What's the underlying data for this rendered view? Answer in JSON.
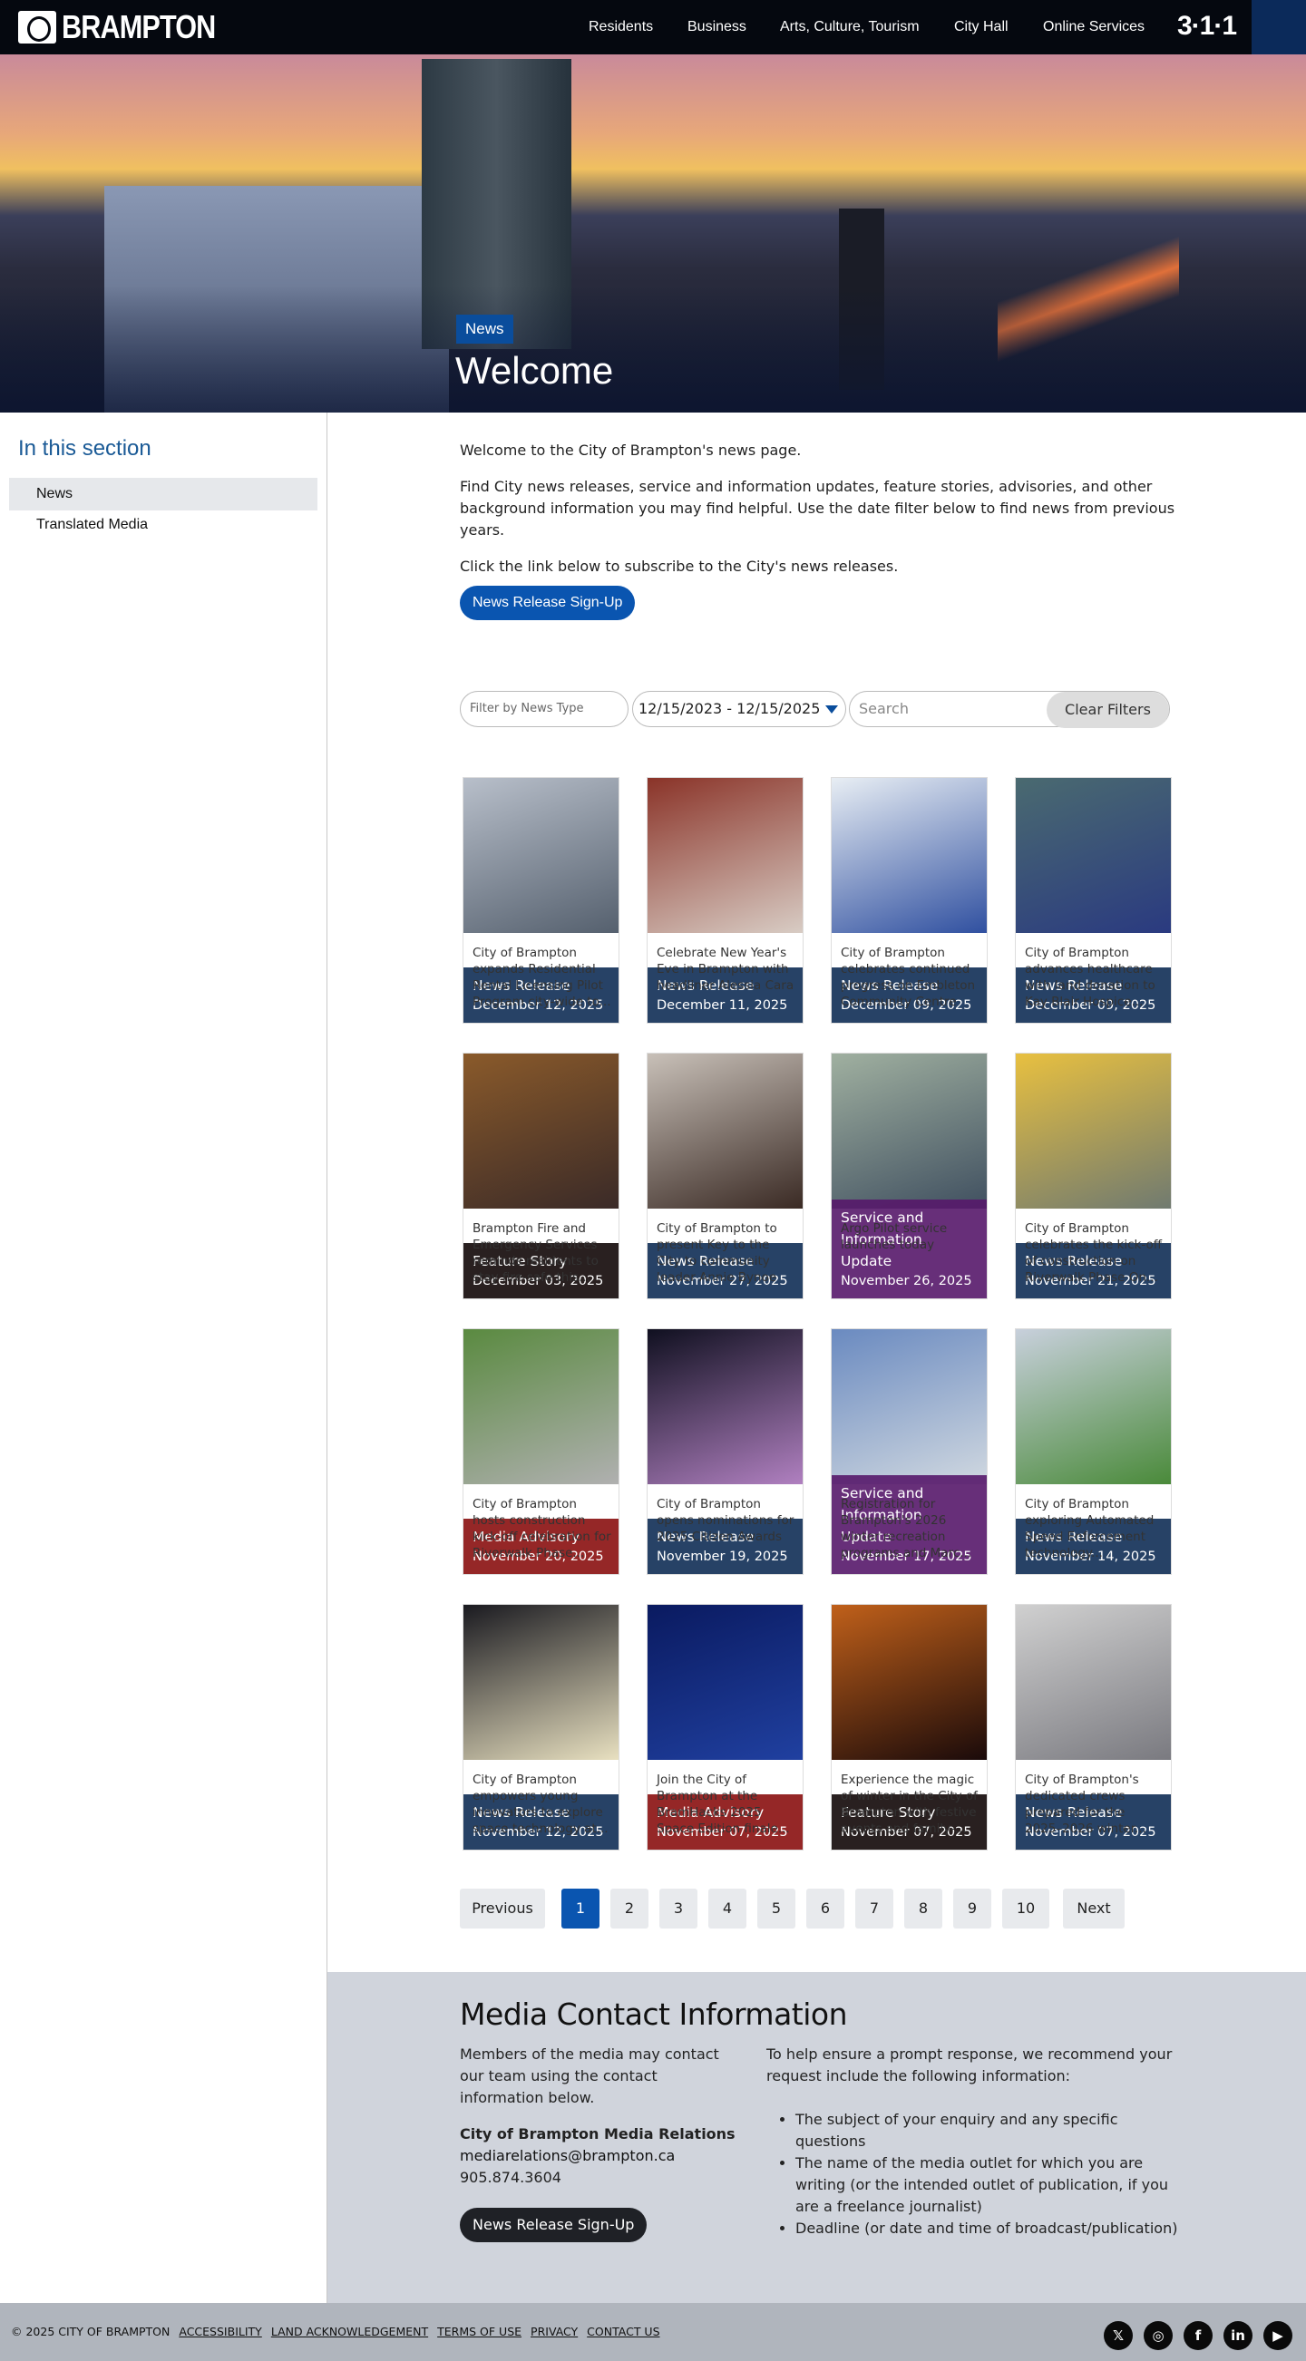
{
  "header": {
    "logo": "BRAMPTON",
    "nav": [
      "Residents",
      "Business",
      "Arts, Culture, Tourism",
      "City Hall",
      "Online Services"
    ],
    "logo_311": "3·1·1"
  },
  "hero": {
    "badge": "News",
    "title": "Welcome"
  },
  "sidebar": {
    "heading": "In this section",
    "items": [
      {
        "label": "News",
        "active": true
      },
      {
        "label": "Translated Media"
      }
    ]
  },
  "intro": {
    "p1": "Welcome to the City of Brampton's news page.",
    "p2": "Find City news releases, service and information updates, feature stories, advisories, and other background information you may find helpful. Use the date filter below to find news from previous years.",
    "p3": "Click the link below to subscribe to the City's news releases.",
    "signup": "News Release Sign-Up"
  },
  "filters": {
    "type_placeholder": "Filter by News Type",
    "date_range": "12/15/2023 - 12/15/2025",
    "search_placeholder": "Search",
    "clear": "Clear Filters"
  },
  "colors": {
    "News Release": "#0f2d55",
    "Media Advisory": "#8a1010",
    "Service and Information Update": "#56186a",
    "Feature Story": "#120808"
  },
  "cards": [
    {
      "type": "News Release",
      "date": "December 12, 2025",
      "title": "City of Brampton expands Residential Rental Licensing Pilot Program city-wide to...",
      "img": [
        "#b8bfca",
        "#55606e"
      ]
    },
    {
      "type": "News Release",
      "date": "December 11, 2025",
      "title": "Celebrate New Year's Eve in Brampton with headliner Alessia Cara",
      "img": [
        "#8a3328",
        "#d8ccc4"
      ]
    },
    {
      "type": "News Release",
      "date": "December 09, 2025",
      "title": "City of Brampton celebrates continued progress on Embleton Community Centre",
      "img": [
        "#e8eef4",
        "#3050a0"
      ]
    },
    {
      "type": "News Release",
      "date": "December 09, 2025",
      "title": "City of Brampton advances healthcare with land donation to Kay Blair Hospice...",
      "img": [
        "#4a6a70",
        "#2a3a80"
      ]
    },
    {
      "type": "Feature Story",
      "date": "December 03, 2025",
      "title": "Brampton Fire and Emergency Services reminds residents to stay fire-safe this...",
      "img": [
        "#8a5a2a",
        "#3a2a28"
      ]
    },
    {
      "type": "News Release",
      "date": "November 27, 2025",
      "title": "City of Brampton to present Key to the City to community leader Annie Bynoe",
      "img": [
        "#c8c0b8",
        "#3a2a24"
      ]
    },
    {
      "type": "Service and Information Update",
      "date": "November 26, 2025",
      "title": "Argo Pilot service launches today",
      "img": [
        "#a0b0a0",
        "#405060"
      ]
    },
    {
      "type": "News Release",
      "date": "November 21, 2025",
      "title": "City of Brampton celebrates the kick-off of construction on Riverwalk Phase On...",
      "img": [
        "#e8c040",
        "#707a70"
      ]
    },
    {
      "type": "Media Advisory",
      "date": "November 20, 2025",
      "title": "City of Brampton hosts construction kick-off celebration for Riverwalk Phase...",
      "img": [
        "#5a8a40",
        "#b0b0b0"
      ]
    },
    {
      "type": "News Release",
      "date": "November 19, 2025",
      "title": "City of Brampton opens nominations for 2025 Citizen Awards",
      "img": [
        "#101020",
        "#b080c0"
      ]
    },
    {
      "type": "Service and Information Update",
      "date": "November 17, 2025",
      "title": "Registration for Brampton's 2026 winter recreation programs and Marc...",
      "img": [
        "#6a8ac0",
        "#d0d8e0"
      ]
    },
    {
      "type": "News Release",
      "date": "November 14, 2025",
      "title": "City of Brampton exploring Automated Speed Enforcement technology...",
      "img": [
        "#c8d0dc",
        "#4a8a3a"
      ]
    },
    {
      "type": "News Release",
      "date": "November 12, 2025",
      "title": "City of Brampton empowers young innovators to explore space technology at...",
      "img": [
        "#1a1a20",
        "#e8e0c0"
      ]
    },
    {
      "type": "Media Advisory",
      "date": "November 07, 2025",
      "title": "Join the City of Brampton at the BramHacks 2025 Space Edition finale...",
      "img": [
        "#0a1a60",
        "#2040a0"
      ]
    },
    {
      "type": "Feature Story",
      "date": "November 07, 2025",
      "title": "Experience the magic of winter in the City of Brampton with festive events and family-...",
      "img": [
        "#c0601a",
        "#1a0a0a"
      ]
    },
    {
      "type": "News Release",
      "date": "November 07, 2025",
      "title": "City of Brampton's dedicated crews prepared for the 2025–2026 winter...",
      "img": [
        "#d0d0d0",
        "#7a7a80"
      ]
    }
  ],
  "pagination": {
    "previous": "Previous",
    "pages": [
      "1",
      "2",
      "3",
      "4",
      "5",
      "6",
      "7",
      "8",
      "9",
      "10"
    ],
    "current": "1",
    "next": "Next"
  },
  "media": {
    "heading": "Media Contact Information",
    "left": "Members of the media may contact our team using the contact information below.",
    "org": "City of Brampton Media Relations",
    "email": "mediarelations@brampton.ca",
    "phone": "905.874.3604",
    "signup": "News Release Sign-Up",
    "right": "To help ensure a prompt response, we recommend your request include the following information:",
    "bullets": [
      "The subject of your enquiry and any specific questions",
      "The name of the media outlet for which you are writing (or the intended outlet of publication, if you are a freelance journalist)",
      "Deadline (or date and time of broadcast/publication)"
    ]
  },
  "footer": {
    "copyright": "© 2025 CITY OF BRAMPTON",
    "links": [
      "ACCESSIBILITY",
      "LAND ACKNOWLEDGEMENT",
      "TERMS OF USE",
      "PRIVACY",
      "CONTACT US"
    ],
    "social": [
      {
        "name": "x",
        "glyph": "𝕏"
      },
      {
        "name": "instagram",
        "glyph": "◎"
      },
      {
        "name": "facebook",
        "glyph": "f"
      },
      {
        "name": "linkedin",
        "glyph": "in"
      },
      {
        "name": "youtube",
        "glyph": "▶"
      }
    ]
  }
}
